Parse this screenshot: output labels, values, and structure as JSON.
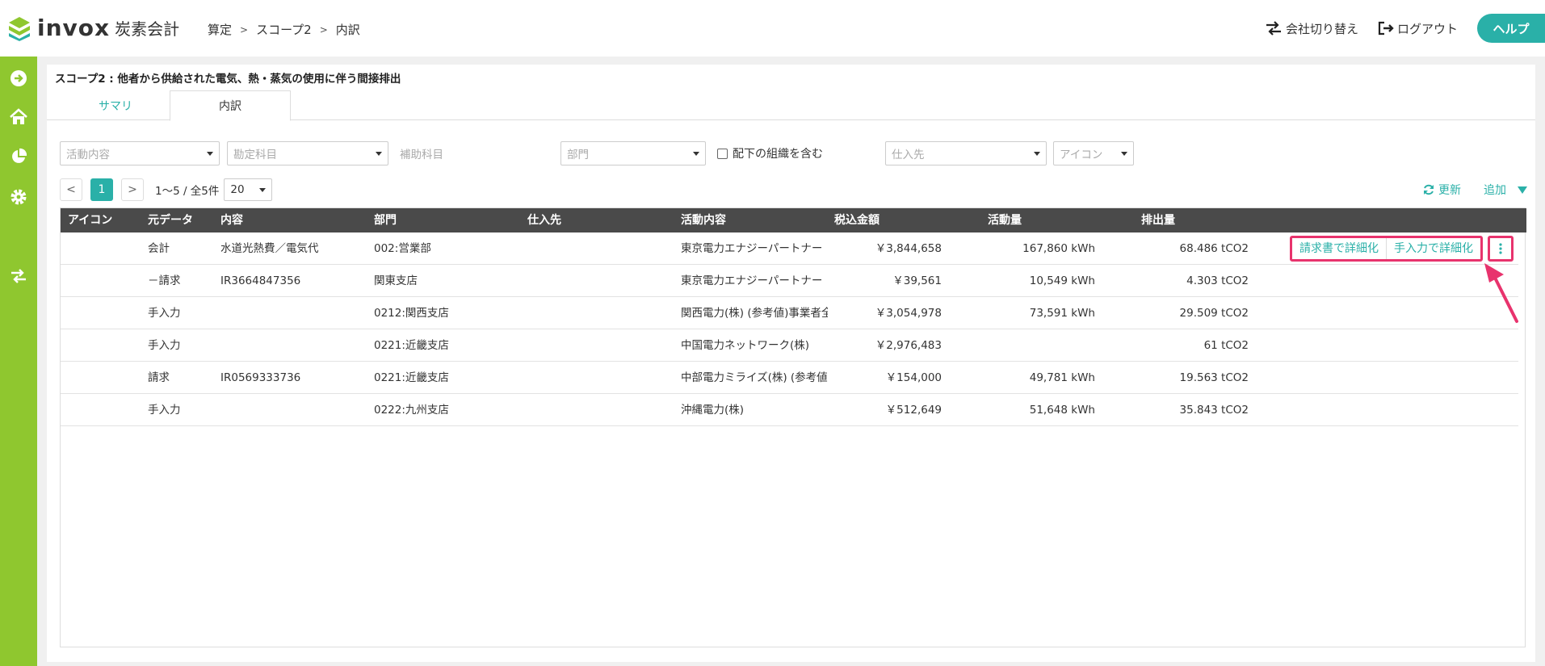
{
  "header": {
    "logo_text": "invox",
    "logo_sub": "炭素会計",
    "breadcrumb": [
      "算定",
      "スコープ2",
      "内訳"
    ],
    "switch_company": "会社切り替え",
    "logout": "ログアウト",
    "help": "ヘルプ"
  },
  "colors": {
    "accent": "#2ab0a8",
    "sidebar": "#8fc72f",
    "highlight": "#e8336d",
    "table_header": "#4a4a4a"
  },
  "page": {
    "title": "スコープ2 : 他者から供給された電気、熱・蒸気の使用に伴う間接排出",
    "tabs": [
      {
        "label": "サマリ",
        "active": false
      },
      {
        "label": "内訳",
        "active": true
      }
    ]
  },
  "filters": {
    "activity_placeholder": "活動内容",
    "account_placeholder": "勘定科目",
    "sub_account_label": "補助科目",
    "department_placeholder": "部門",
    "include_children_label": "配下の組織を含む",
    "supplier_placeholder": "仕入先",
    "icon_placeholder": "アイコン"
  },
  "pagination": {
    "prev": "<",
    "current": "1",
    "next": ">",
    "info": "1〜5 / 全5件",
    "page_size": "20"
  },
  "actions": {
    "refresh": "更新",
    "add": "追加"
  },
  "table": {
    "headers": [
      "アイコン",
      "元データ",
      "内容",
      "部門",
      "仕入先",
      "活動内容",
      "税込金額",
      "活動量",
      "排出量"
    ],
    "rows": [
      {
        "source": "会計",
        "content": "水道光熱費／電気代",
        "department": "002:営業部",
        "supplier": "",
        "activity": "東京電力エナジーパートナー",
        "amount": "￥3,844,658",
        "quantity": "167,860 kWh",
        "emission": "68.486 tCO2"
      },
      {
        "source": "－請求",
        "content": "IR3664847356",
        "department": "関東支店",
        "supplier": "",
        "activity": "東京電力エナジーパートナー",
        "amount": "￥39,561",
        "quantity": "10,549 kWh",
        "emission": "4.303 tCO2"
      },
      {
        "source": "手入力",
        "content": "",
        "department": "0212:関西支店",
        "supplier": "",
        "activity": "関西電力(株) (参考値)事業者全",
        "amount": "￥3,054,978",
        "quantity": "73,591 kWh",
        "emission": "29.509 tCO2"
      },
      {
        "source": "手入力",
        "content": "",
        "department": "0221:近畿支店",
        "supplier": "",
        "activity": "中国電力ネットワーク(株)",
        "amount": "￥2,976,483",
        "quantity": "",
        "emission": "61 tCO2"
      },
      {
        "source": "請求",
        "content": "IR0569333736",
        "department": "0221:近畿支店",
        "supplier": "",
        "activity": "中部電力ミライズ(株) (参考値",
        "amount": "￥154,000",
        "quantity": "49,781 kWh",
        "emission": "19.563 tCO2"
      },
      {
        "source": "手入力",
        "content": "",
        "department": "0222:九州支店",
        "supplier": "",
        "activity": "沖縄電力(株)",
        "amount": "￥512,649",
        "quantity": "51,648 kWh",
        "emission": "35.843 tCO2"
      }
    ],
    "row_actions": {
      "detail_by_invoice": "請求書で詳細化",
      "detail_by_manual": "手入力で詳細化"
    }
  }
}
